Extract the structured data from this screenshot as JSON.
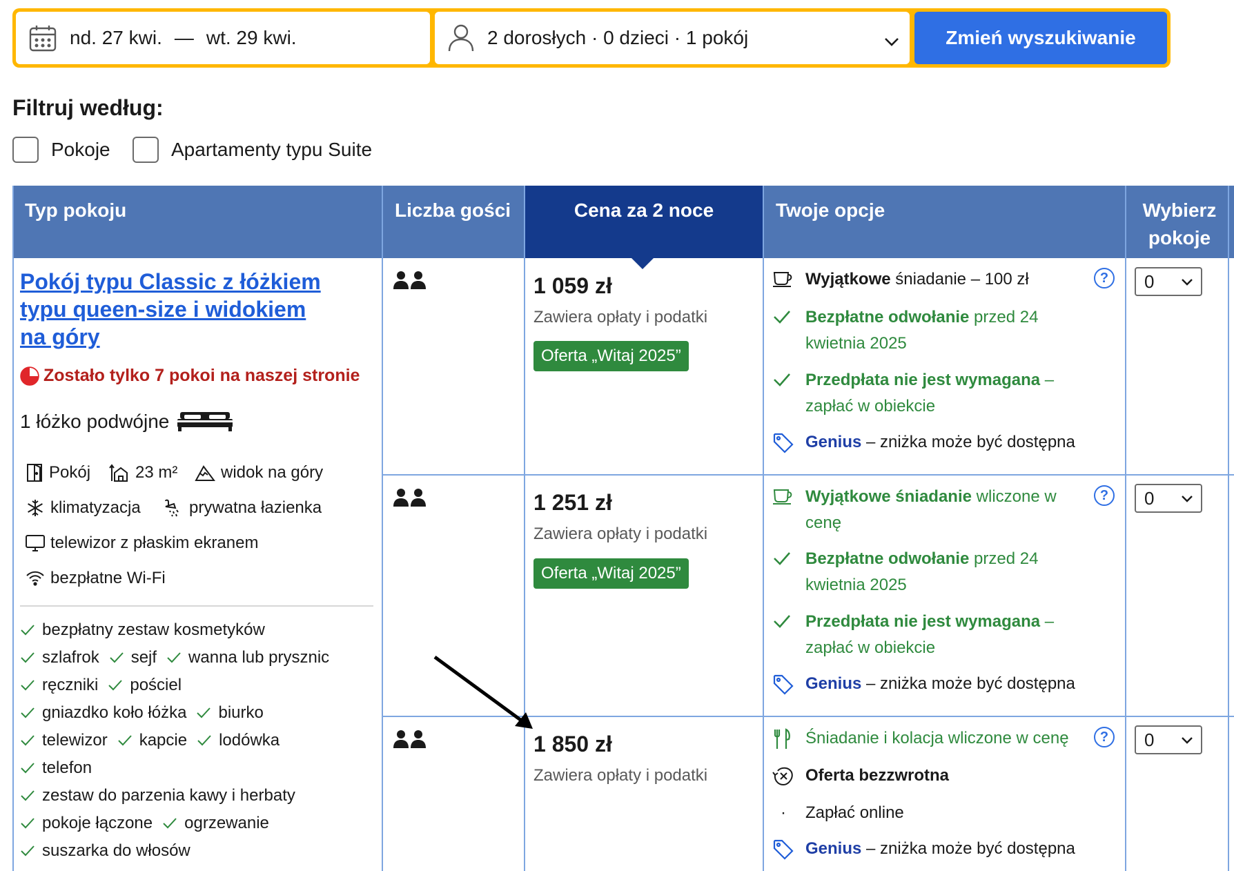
{
  "search": {
    "check_in": "nd. 27 kwi.",
    "dash": "—",
    "check_out": "wt. 29 kwi.",
    "occupancy": "2 dorosłych · 0 dzieci · 1 pokój",
    "submit_label": "Zmień wyszukiwanie"
  },
  "filters": {
    "title": "Filtruj według:",
    "options": [
      "Pokoje",
      "Apartamenty typu Suite"
    ]
  },
  "table": {
    "headers": {
      "room_type": "Typ pokoju",
      "guests": "Liczba gości",
      "price": "Cena za 2 noce",
      "options": "Twoje opcje",
      "select_line1": "Wybierz",
      "select_line2": "pokoje"
    }
  },
  "room": {
    "name_line1": "Pokój typu Classic z łóżkiem",
    "name_line2": "typu queen-size i widokiem",
    "name_line3": "na góry",
    "scarcity": "Zostało tylko 7 pokoi na naszej stronie",
    "bed": "1 łóżko podwójne",
    "facilities": {
      "room": "Pokój",
      "size": "23 m²",
      "view": "widok na góry",
      "ac": "klimatyzacja",
      "bathroom": "prywatna łazienka",
      "tv": "telewizor z płaskim ekranem",
      "wifi": "bezpłatne Wi-Fi"
    },
    "amenity_lines": [
      [
        "bezpłatny zestaw kosmetyków"
      ],
      [
        "szlafrok",
        "sejf",
        "wanna lub prysznic"
      ],
      [
        "ręczniki",
        "pościel"
      ],
      [
        "gniazdko koło łóżka",
        "biurko"
      ],
      [
        "telewizor",
        "kapcie",
        "lodówka"
      ],
      [
        "telefon"
      ],
      [
        "zestaw do parzenia kawy i herbaty"
      ],
      [
        "pokoje łączone",
        "ogrzewanie"
      ],
      [
        "suszarka do włosów"
      ]
    ]
  },
  "common": {
    "price_note": "Zawiera opłaty i podatki",
    "help": "?",
    "genius": "Genius",
    "genius_rest": " – zniżka może być dostępna",
    "free_cancel_bold": "Bezpłatne odwołanie",
    "free_cancel_rest": " przed 24",
    "free_cancel_line2": "kwietnia 2025",
    "no_prepay_bold": "Przedpłata nie jest wymagana",
    "no_prepay_dash": " –",
    "no_prepay_line2": "zapłać w obiekcie"
  },
  "offers": [
    {
      "price": "1 059 zł",
      "badge": "Oferta „Witaj 2025”",
      "breakfast_bold": "Wyjątkowe",
      "breakfast_rest": " śniadanie – 100 zł",
      "quantity": "0"
    },
    {
      "price": "1 251 zł",
      "badge": "Oferta „Witaj 2025”",
      "breakfast_bold": "Wyjątkowe śniadanie",
      "breakfast_rest": " wliczone w",
      "breakfast_line2": "cenę",
      "quantity": "0"
    },
    {
      "price": "1 850 zł",
      "meals": "Śniadanie i kolacja wliczone w cenę",
      "nonrefundable": "Oferta bezzwrotna",
      "pay_bullet": "·",
      "pay_online": "Zapłać online",
      "quantity": "0"
    }
  ]
}
